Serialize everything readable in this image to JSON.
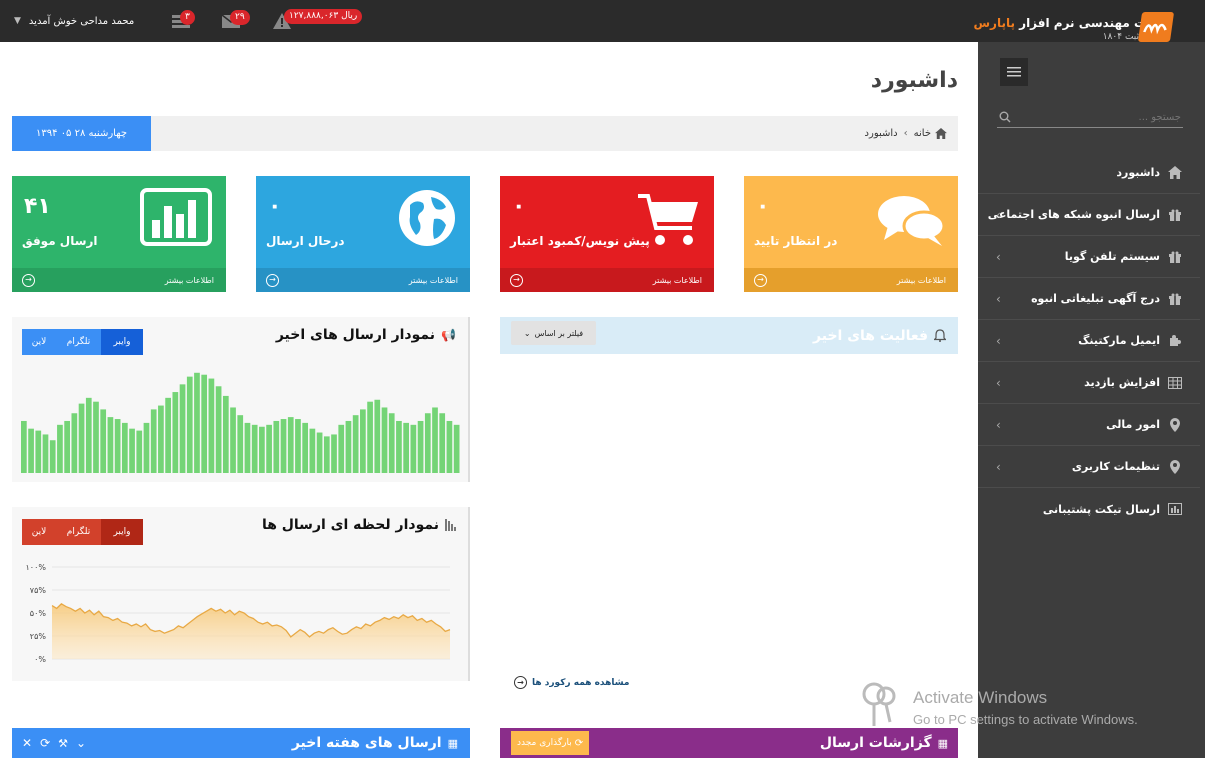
{
  "topbar": {
    "user_label": "محمد مداحی خوش آمدید",
    "tasks_badge": "۳",
    "mail_badge": "۲۹",
    "credit": "۱۲۷,۸۸۸,۰۶۳ ریال",
    "company_prefix": "شرکت مهندسی نرم افزار ",
    "company_brand": "پاپارس",
    "reg_label": "ثبت ۱۸۰۴"
  },
  "colors": {
    "accent_orange": "#f07c1e",
    "topbar": "#2b2b2b",
    "sidebar": "#3d3d3d"
  },
  "page": {
    "title": "داشبورد",
    "date": "چهارشنبه ۲۸ ۰۵ ۱۳۹۴",
    "breadcrumb": {
      "home": "خانه",
      "current": "داشبورد"
    }
  },
  "sidebar": {
    "search_placeholder": "جستجو ...",
    "items": [
      {
        "label": "داشبورد",
        "icon": "home-icon"
      },
      {
        "label": "ارسال انبوه شبکه های اجتماعی",
        "icon": "gift-icon"
      },
      {
        "label": "سیستم تلفن گویا",
        "icon": "gift-icon"
      },
      {
        "label": "درج آگهی تبلیغاتی انبوه",
        "icon": "gift-icon"
      },
      {
        "label": "ایمیل مارکتینگ",
        "icon": "puzzle-icon"
      },
      {
        "label": "افزایش بازدید",
        "icon": "table-icon"
      },
      {
        "label": "امور مالی",
        "icon": "map-marker-icon"
      },
      {
        "label": "تنظیمات کاربری",
        "icon": "map-marker-icon"
      },
      {
        "label": "ارسال تیکت پشتیبانی",
        "icon": "bar-chart-icon"
      }
    ]
  },
  "tiles": [
    {
      "number": "۴۱",
      "label": "ارسال موفق",
      "more": "اطلاعات بیشتر",
      "color": "#2eb46b",
      "footer_color": "#27a05e",
      "icon": "bar-chart-icon"
    },
    {
      "number": "۰",
      "label": "درحال ارسال",
      "more": "اطلاعات بیشتر",
      "color": "#2da6df",
      "footer_color": "#2792c5",
      "icon": "globe-icon"
    },
    {
      "number": "۰",
      "label": "پیش نویس/کمبود اعتبار",
      "more": "اطلاعات بیشتر",
      "color": "#e41d21",
      "footer_color": "#c8191d",
      "icon": "cart-icon"
    },
    {
      "number": "۰",
      "label": "در انتظار تایید",
      "more": "اطلاعات بیشتر",
      "color": "#fdb94d",
      "footer_color": "#e59f2c",
      "icon": "comments-icon"
    }
  ],
  "recent_chart": {
    "title": "نمودار ارسال های اخیر",
    "tabs": [
      "وایبر",
      "تلگرام",
      "لاین"
    ]
  },
  "realtime_chart": {
    "title": "نمودار لحظه ای ارسال ها",
    "tabs": [
      "وایبر",
      "تلگرام",
      "لاین"
    ],
    "yticks": [
      "۱۰۰%",
      "۷۵%",
      "۵۰%",
      "۲۵%",
      "۰%"
    ]
  },
  "activity": {
    "title": "فعالیت های اخیر",
    "filter": "فیلتر بر اساس",
    "view_all": "مشاهده همه رکورد ها"
  },
  "bottom": {
    "weekly_title": "ارسال های هفته اخیر",
    "reports_title": "گزارشات ارسال",
    "reload": "بارگذاری مجدد"
  },
  "watermark": {
    "line1": "Activate Windows",
    "line2": "Go to PC settings to activate Windows."
  },
  "chart_data": [
    {
      "type": "bar",
      "values": [
        27,
        23,
        22,
        20,
        17,
        25,
        27,
        31,
        36,
        39,
        37,
        33,
        29,
        28,
        26,
        23,
        22,
        26,
        33,
        35,
        39,
        42,
        46,
        50,
        52,
        51,
        49,
        45,
        40,
        34,
        30,
        26,
        25,
        24,
        25,
        27,
        28,
        29,
        28,
        26,
        23,
        21,
        19,
        20,
        25,
        27,
        30,
        33,
        37,
        38,
        34,
        31,
        27,
        26,
        25,
        27,
        31,
        34,
        31,
        27,
        25
      ],
      "ylim": [
        0,
        55
      ]
    },
    {
      "type": "area",
      "y": [
        58,
        55,
        60,
        57,
        55,
        52,
        55,
        50,
        53,
        48,
        52,
        46,
        45,
        42,
        44,
        40,
        39,
        36,
        38,
        35,
        38,
        32,
        30,
        31,
        28,
        30,
        32,
        36,
        34,
        38,
        42,
        46,
        49,
        52,
        55,
        52,
        54,
        50,
        53,
        48,
        52,
        50,
        46,
        44,
        40,
        38,
        40,
        36,
        37,
        35,
        31,
        24,
        28,
        32,
        29,
        24,
        28,
        30,
        28,
        32,
        34,
        30,
        27,
        28,
        32,
        35,
        33,
        38,
        36,
        40,
        42,
        45,
        43,
        46,
        44,
        48,
        45,
        47,
        42,
        44,
        40,
        42,
        38,
        35,
        30,
        32
      ],
      "yticks": [
        "۱۰۰%",
        "۷۵%",
        "۵۰%",
        "۲۵%",
        "۰%"
      ],
      "ylim": [
        0,
        100
      ],
      "grid": true
    }
  ]
}
